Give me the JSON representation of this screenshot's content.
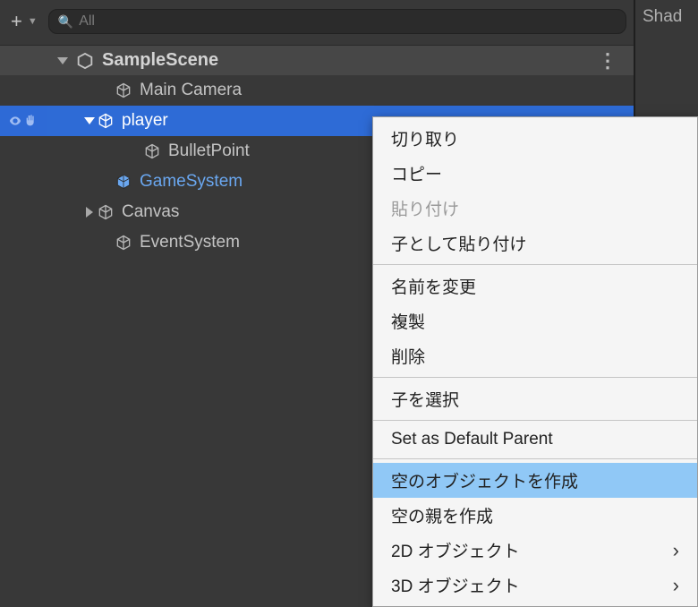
{
  "sidePanel": {
    "title": "Shad"
  },
  "search": {
    "placeholder": "All"
  },
  "scene": {
    "name": "SampleScene"
  },
  "tree": {
    "mainCamera": "Main Camera",
    "player": "player",
    "bulletPoint": "BulletPoint",
    "gameSystem": "GameSystem",
    "canvas": "Canvas",
    "eventSystem": "EventSystem"
  },
  "ctx": {
    "cut": "切り取り",
    "copy": "コピー",
    "paste": "貼り付け",
    "pasteAsChild": "子として貼り付け",
    "rename": "名前を変更",
    "duplicate": "複製",
    "delete": "削除",
    "selectChildren": "子を選択",
    "setDefaultParent": "Set as Default Parent",
    "createEmpty": "空のオブジェクトを作成",
    "createEmptyParent": "空の親を作成",
    "obj2d": "2D オブジェクト",
    "obj3d": "3D オブジェクト"
  }
}
